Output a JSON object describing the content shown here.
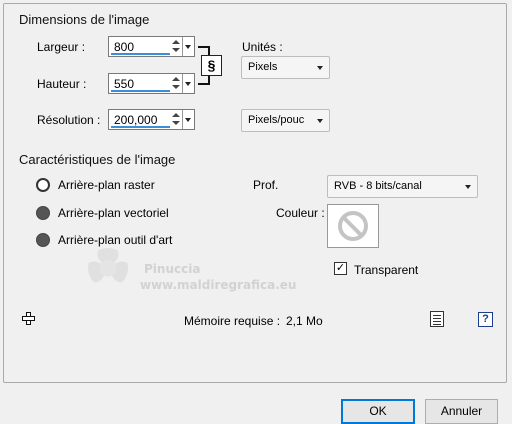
{
  "image_dimensions": {
    "title": "Dimensions de l'image",
    "width_label": "Largeur :",
    "width_value": "800",
    "height_label": "Hauteur :",
    "height_value": "550",
    "resolution_label": "Résolution :",
    "resolution_value": "200,000",
    "units_label": "Unités :",
    "units_value": "Pixels",
    "resolution_units_value": "Pixels/pouc",
    "link_icon": "link-aspect-icon"
  },
  "image_characteristics": {
    "title": "Caractéristiques de l'image",
    "background_options": [
      {
        "label": "Arrière-plan raster",
        "selected": true
      },
      {
        "label": "Arrière-plan vectoriel",
        "selected": false
      },
      {
        "label": "Arrière-plan outil d'art",
        "selected": false
      }
    ],
    "depth_label": "Prof.",
    "depth_value": "RVB - 8 bits/canal",
    "color_label": "Couleur :",
    "color_icon": "no-color-icon",
    "transparent_label": "Transparent",
    "transparent_checked": true
  },
  "memory": {
    "label": "Mémoire requise :",
    "value": "2,1 Mo"
  },
  "watermark": {
    "name": "Pinuccia",
    "url": "www.maldiregrafica.eu"
  },
  "buttons": {
    "ok": "OK",
    "cancel": "Annuler"
  },
  "colors": {
    "background": "#f0f0f0",
    "accent": "#3c8ed8",
    "ok_border": "#0078d7"
  }
}
